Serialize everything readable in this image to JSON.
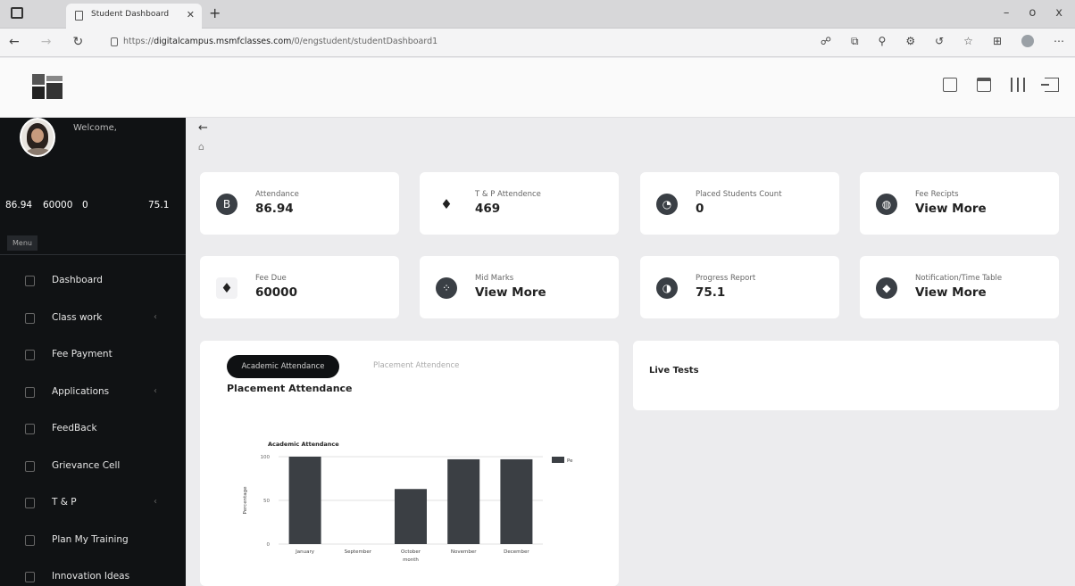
{
  "browser": {
    "tab_title": "Student Dashboard",
    "url_prefix": "https://",
    "url_domain": "digitalcampus.msmfclasses.com",
    "url_path": "/0/engstudent/studentDashboard1",
    "window_controls": [
      "–",
      "o",
      "x"
    ]
  },
  "sidebar": {
    "welcome": "Welcome,",
    "stats": [
      "86.94",
      "60000",
      "0",
      "75.1"
    ],
    "menu_tab": "Menu",
    "items": [
      {
        "label": "Dashboard",
        "chevron": false
      },
      {
        "label": "Class work",
        "chevron": true
      },
      {
        "label": "Fee Payment",
        "chevron": false
      },
      {
        "label": "Applications",
        "chevron": true
      },
      {
        "label": "FeedBack",
        "chevron": false
      },
      {
        "label": "Grievance Cell",
        "chevron": false
      },
      {
        "label": "T & P",
        "chevron": true
      },
      {
        "label": "Plan My Training",
        "chevron": false
      },
      {
        "label": "Innovation Ideas",
        "chevron": false
      }
    ]
  },
  "cards": [
    {
      "label": "Attendance",
      "value": "86.94",
      "icon": "bitcoin-icon"
    },
    {
      "label": "T & P Attendence",
      "value": "469",
      "icon": "ethereum-icon"
    },
    {
      "label": "Placed Students Count",
      "value": "0",
      "icon": "chart-icon"
    },
    {
      "label": "Fee Recipts",
      "value": "View More",
      "icon": "globe-icon"
    },
    {
      "label": "Fee Due",
      "value": "60000",
      "icon": "ethereum-icon"
    },
    {
      "label": "Mid Marks",
      "value": "View More",
      "icon": "cluster-icon"
    },
    {
      "label": "Progress Report",
      "value": "75.1",
      "icon": "gauge-icon"
    },
    {
      "label": "Notification/Time Table",
      "value": "View More",
      "icon": "shield-icon"
    }
  ],
  "attendance_panel": {
    "tab_active": "Academic Attendance",
    "tab_inactive": "Placement Attendence",
    "title": "Placement Attendance"
  },
  "live_tests": {
    "title": "Live Tests"
  },
  "chart_data": {
    "type": "bar",
    "title": "Academic Attendance",
    "xlabel": "month",
    "ylabel": "Percentage",
    "categories": [
      "January",
      "September",
      "October",
      "November",
      "December"
    ],
    "series": [
      {
        "name": "Pe",
        "values": [
          100,
          0,
          63,
          97,
          97
        ],
        "color": "#3b3f44"
      }
    ],
    "ylim": [
      0,
      100
    ],
    "yticks": [
      0,
      50,
      100
    ],
    "legend": "top-right",
    "grid": true
  }
}
